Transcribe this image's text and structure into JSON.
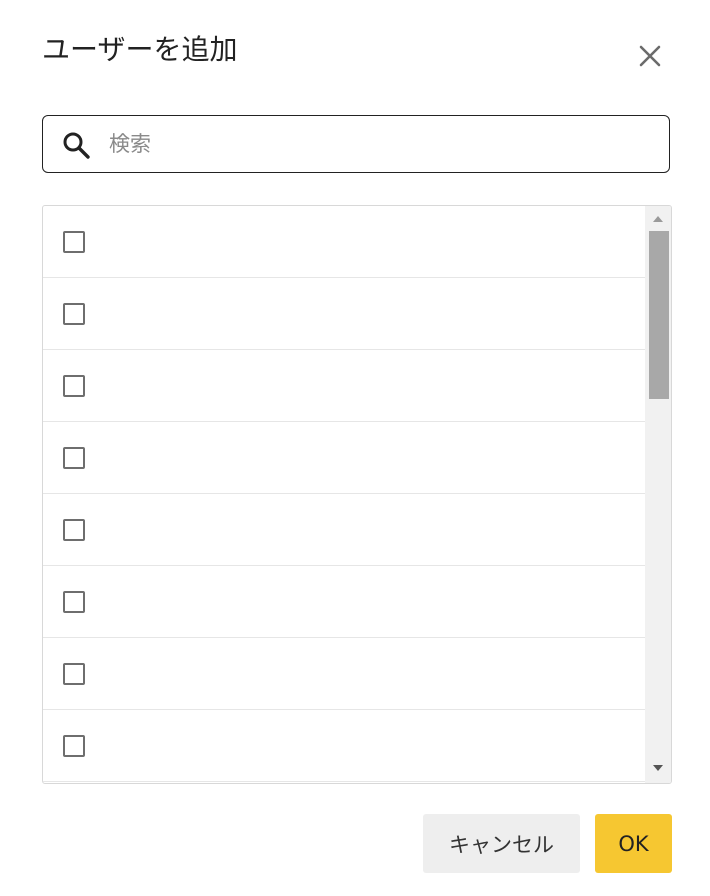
{
  "dialog": {
    "title": "ユーザーを追加",
    "close_icon": "close-icon"
  },
  "search": {
    "placeholder": "検索",
    "value": "",
    "icon": "search-icon"
  },
  "user_list": {
    "rows": [
      {
        "checked": false,
        "label": ""
      },
      {
        "checked": false,
        "label": ""
      },
      {
        "checked": false,
        "label": ""
      },
      {
        "checked": false,
        "label": ""
      },
      {
        "checked": false,
        "label": ""
      },
      {
        "checked": false,
        "label": ""
      },
      {
        "checked": false,
        "label": ""
      },
      {
        "checked": false,
        "label": ""
      }
    ]
  },
  "footer": {
    "cancel_label": "キャンセル",
    "ok_label": "OK"
  },
  "colors": {
    "ok_button": "#f6c731",
    "cancel_button": "#eeeeee",
    "scrollbar_thumb": "#a8a8a8"
  }
}
